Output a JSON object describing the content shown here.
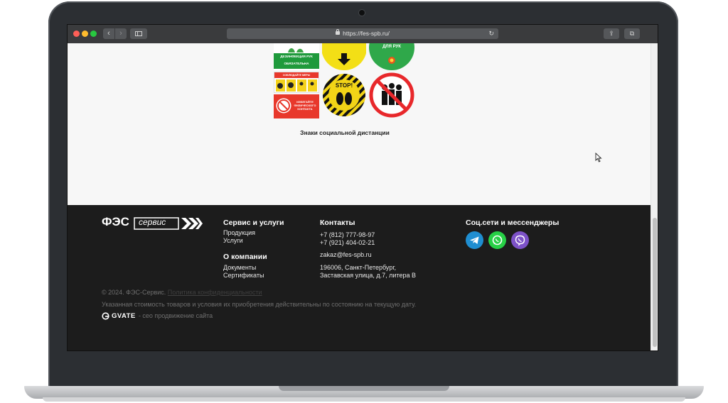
{
  "browser": {
    "url": "https://fes-spb.ru/",
    "reload_glyph": "↻",
    "back_glyph": "‹",
    "forward_glyph": "›",
    "share_glyph": "⇪",
    "tabs_glyph": "⧉"
  },
  "content": {
    "image_caption": "Знаки социальной дистанции",
    "signs": {
      "sign1_text": "ДЕЗИНФЕКЦИЯ РУК ОБЯЗАТЕЛЬНА",
      "sign2_text": "ДЛЯ РУК",
      "sign3_text": "СОБЛЮДАЙТЕ МЕРЫ ПРЕДОСТОРОЖНОСТИ",
      "sign4_text": "ИЗБЕГАЙТЕ ФИЗИЧЕСКОГО КОНТАКТА",
      "sign5_text": "STOP!"
    }
  },
  "footer": {
    "logo": {
      "part1": "ФЭС",
      "part2": "сервис"
    },
    "services": {
      "title": "Сервис и услуги",
      "links": [
        "Продукция",
        "Услуги"
      ]
    },
    "company": {
      "title": "О компании",
      "links": [
        "Документы",
        "Сертификаты"
      ]
    },
    "contacts": {
      "title": "Контакты",
      "phone1": "+7 (812) 777-98-97",
      "phone2": "+7 (921) 404-02-21",
      "email": "zakaz@fes-spb.ru",
      "address_line1": "196006, Санкт-Петербург,",
      "address_line2": "Заставская улица, д.7, литера В"
    },
    "social": {
      "title": "Соц.сети и мессенджеры",
      "icons": [
        "telegram-icon",
        "whatsapp-icon",
        "viber-icon"
      ],
      "colors": {
        "telegram": "#1f8ed1",
        "whatsapp": "#27d046",
        "viber": "#7d52c8"
      }
    },
    "copyright": "© 2024. ФЭС-Сервис.",
    "privacy_link": "Политика конфиденциальности",
    "disclaimer": "Указанная стоимость товаров и условия их приобретения действительны по состоянию на текущую дату.",
    "gvate": {
      "brand": "GVATE",
      "text": "- сео продвижение сайта"
    }
  }
}
